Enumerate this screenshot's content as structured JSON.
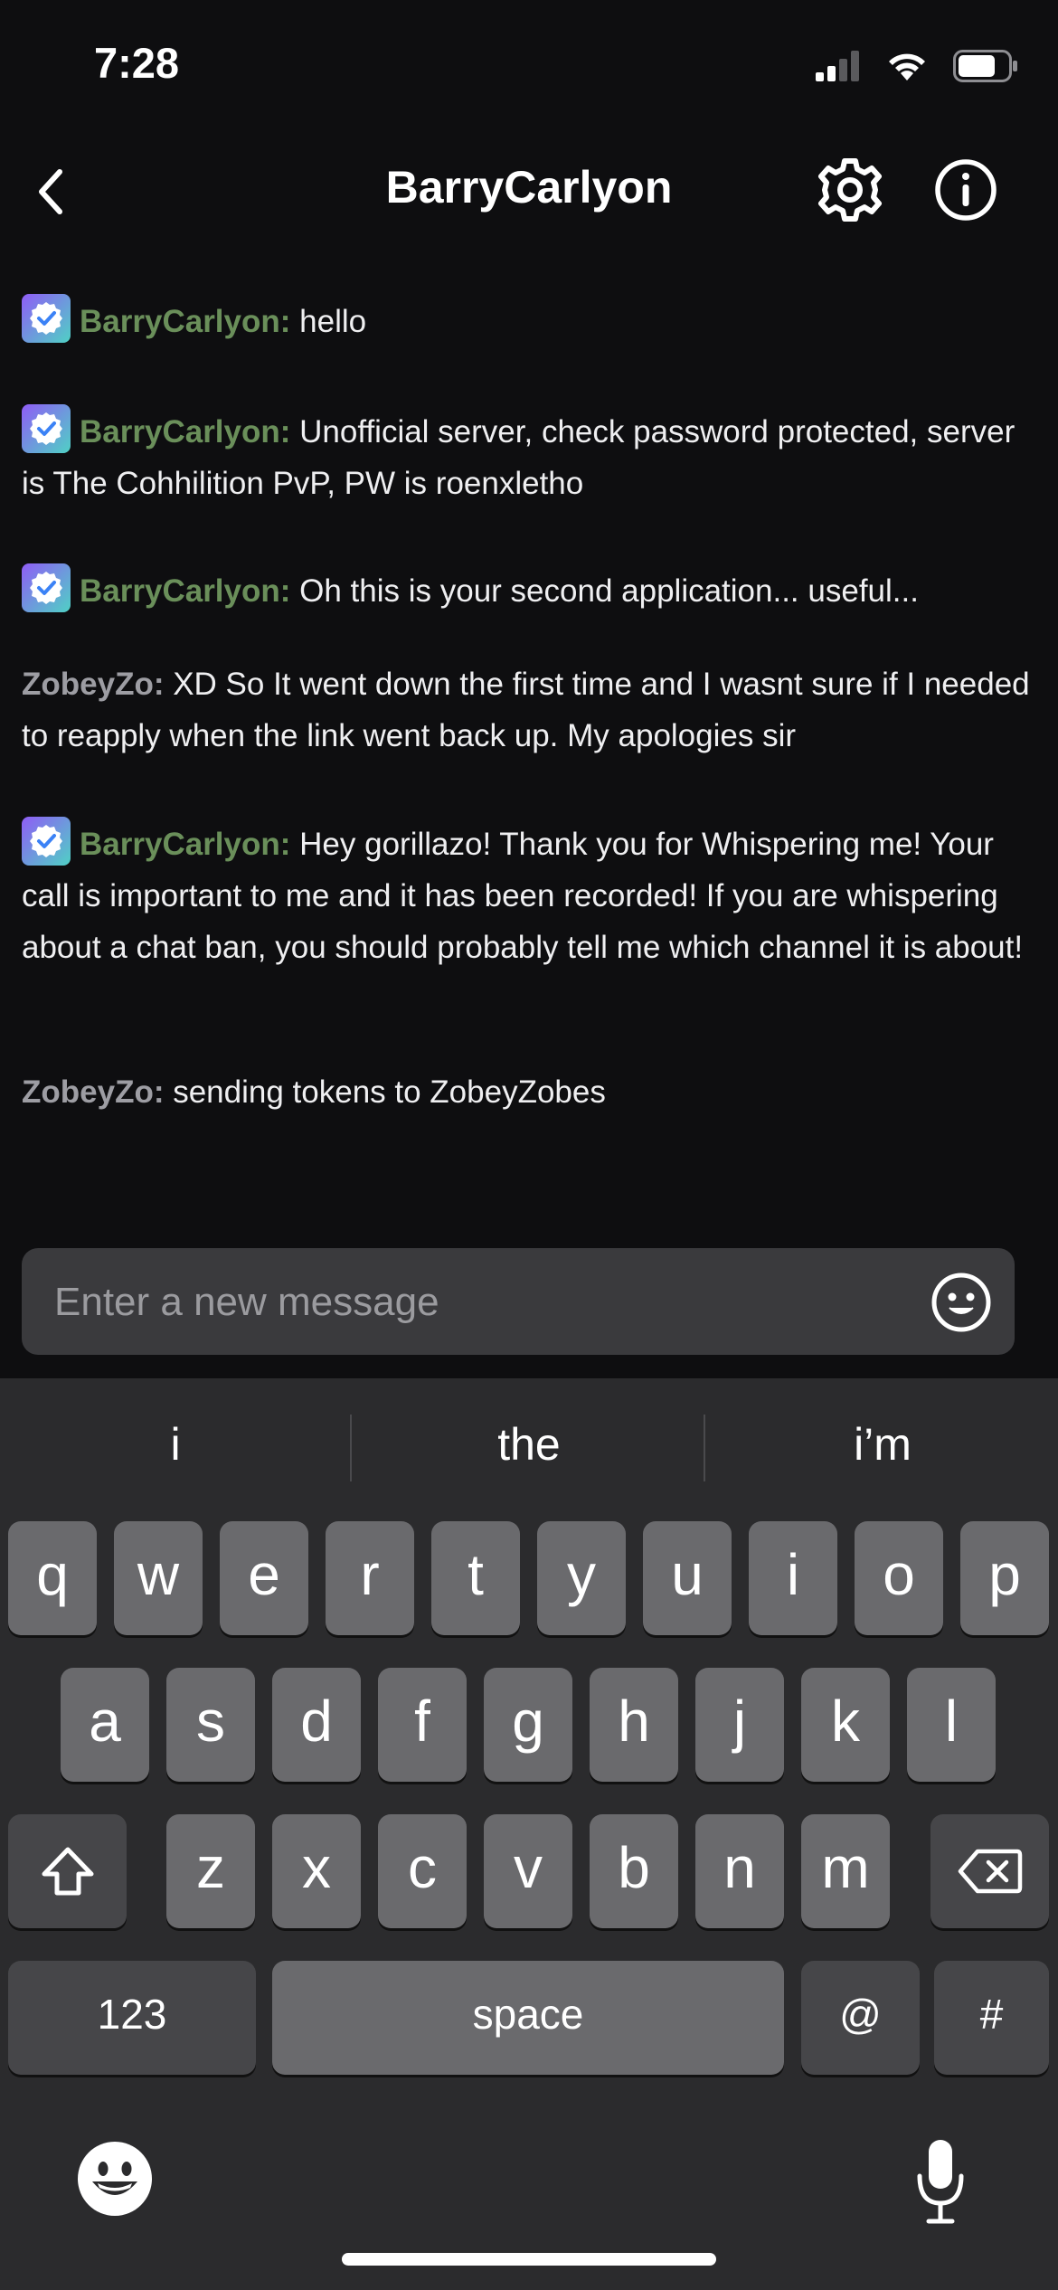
{
  "status": {
    "time": "7:28",
    "icons": [
      "cellular-signal-icon",
      "wifi-icon",
      "battery-icon"
    ]
  },
  "header": {
    "title": "BarryCarlyon",
    "icons": [
      "back-chevron-icon",
      "gear-icon",
      "info-icon"
    ]
  },
  "messages": [
    {
      "user": "BarryCarlyon:",
      "text": " hello",
      "badge": true
    },
    {
      "user": "BarryCarlyon:",
      "text": " Unofficial server, check password protected, server is The Cohhilition PvP, PW is roenxletho",
      "badge": true
    },
    {
      "user": "BarryCarlyon:",
      "text": " Oh this is your second application... useful...",
      "badge": true
    },
    {
      "user": "ZobeyZo:",
      "text": " XD So It went down the first time and I wasnt sure if I needed to reapply when the link went back up. My apologies sir",
      "badge": false
    },
    {
      "user": "BarryCarlyon:",
      "text": " Hey gorillazo! Thank you for Whispering me! Your call is important to me and it has been recorded! If you are whispering about a chat ban, you should probably tell me which channel it is about!",
      "badge": true
    },
    {
      "user": "ZobeyZo:",
      "text": " sending tokens to ZobeyZobes",
      "badge": false
    }
  ],
  "colors": {
    "background": "#0e0e10",
    "barry_name": "#6a8f5a",
    "zobey_name": "#9d9da3",
    "badge_gradient": [
      "#8f5cf6",
      "#4fd1c5"
    ]
  },
  "composer": {
    "placeholder": "Enter a new message",
    "value": "",
    "emote_icon": "smiley-icon"
  },
  "keyboard": {
    "suggestions": [
      "i",
      "the",
      "i’m"
    ],
    "row1": [
      "q",
      "w",
      "e",
      "r",
      "t",
      "y",
      "u",
      "i",
      "o",
      "p"
    ],
    "row2": [
      "a",
      "s",
      "d",
      "f",
      "g",
      "h",
      "j",
      "k",
      "l"
    ],
    "row3": [
      "z",
      "x",
      "c",
      "v",
      "b",
      "n",
      "m"
    ],
    "numbers_label": "123",
    "space_label": "space",
    "at_label": "@",
    "hash_label": "#"
  }
}
